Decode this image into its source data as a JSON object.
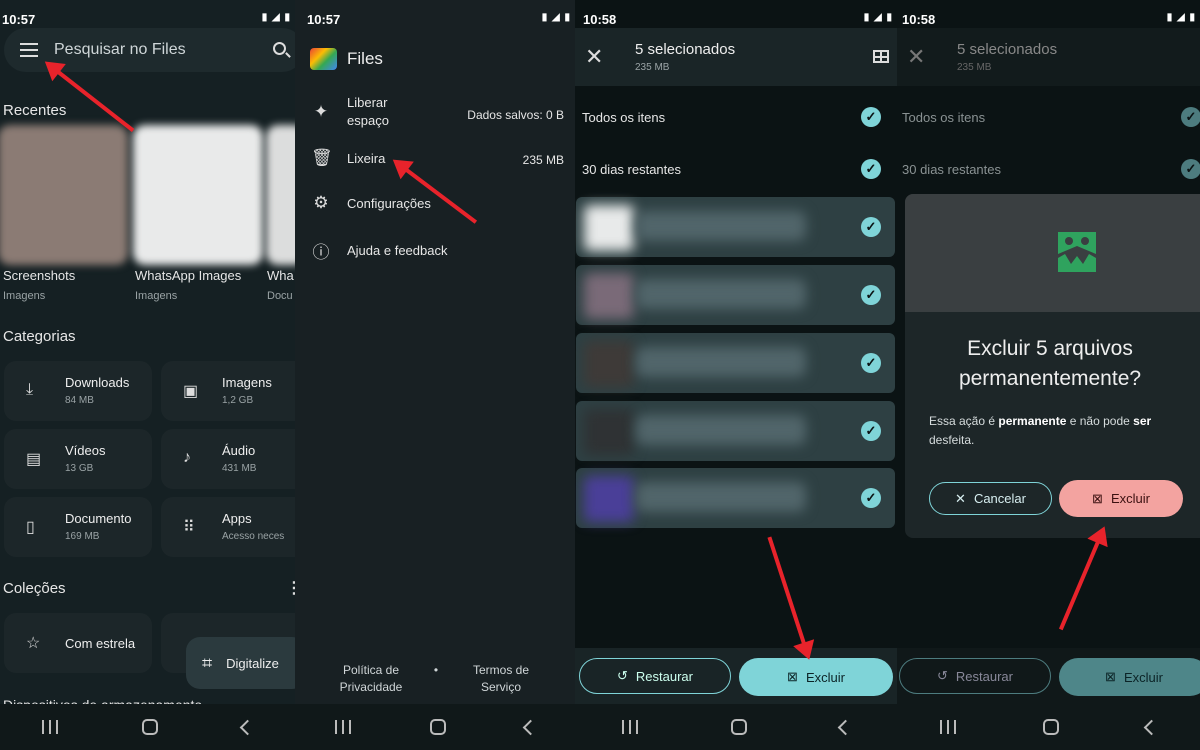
{
  "status": {
    "time1": "10:57",
    "time2": "10:57",
    "time3": "10:58",
    "time4": "10:58",
    "network": "LTE1"
  },
  "home": {
    "search_placeholder": "Pesquisar no Files",
    "recent_title": "Recentes",
    "recents": [
      {
        "title": "Screenshots",
        "sub": "Imagens"
      },
      {
        "title": "WhatsApp Images",
        "sub": "Imagens"
      },
      {
        "title": "Wha",
        "sub": "Docu"
      }
    ],
    "categories_title": "Categorias",
    "categories": [
      {
        "title": "Downloads",
        "sub": "84 MB",
        "icon": "download-icon"
      },
      {
        "title": "Imagens",
        "sub": "1,2 GB",
        "icon": "image-icon"
      },
      {
        "title": "Vídeos",
        "sub": "13 GB",
        "icon": "video-icon"
      },
      {
        "title": "Áudio",
        "sub": "431 MB",
        "icon": "music-icon"
      },
      {
        "title": "Documento",
        "sub": "169 MB",
        "icon": "document-icon"
      },
      {
        "title": "Apps",
        "sub": "Acesso neces",
        "icon": "apps-icon"
      }
    ],
    "collections_title": "Coleções",
    "starred": "Com estrela",
    "scan_fab": "Digitalize",
    "storage_title": "Dispositivos de armazenamento"
  },
  "drawer": {
    "app_name": "Files",
    "items": [
      {
        "label": "Liberar espaço",
        "right": "Dados salvos: 0 B",
        "icon": "sparkle-icon"
      },
      {
        "label": "Lixeira",
        "right": "235 MB",
        "icon": "trash-icon"
      },
      {
        "label": "Configurações",
        "right": "",
        "icon": "gear-icon"
      },
      {
        "label": "Ajuda e feedback",
        "right": "",
        "icon": "help-icon"
      }
    ],
    "privacy": "Política de Privacidade",
    "terms": "Termos de Serviço",
    "dot": "•"
  },
  "trash": {
    "title": "5 selecionados",
    "size": "235 MB",
    "all_items": "Todos os itens",
    "days_left": "30 dias restantes",
    "file_rows": 5,
    "restore": "Restaurar",
    "delete": "Excluir"
  },
  "dialog": {
    "title": "Excluir 5 arquivos permanentemente?",
    "body_pre": "Essa ação é ",
    "body_b1": "permanente",
    "body_mid": " e não pode ",
    "body_b2": "ser",
    "body_post": "desfeita.",
    "cancel": "Cancelar",
    "confirm": "Excluir"
  },
  "colors": {
    "accent": "#7fd4d8",
    "danger_button": "#f3a3a0",
    "annotation_arrow": "#e8232b"
  }
}
